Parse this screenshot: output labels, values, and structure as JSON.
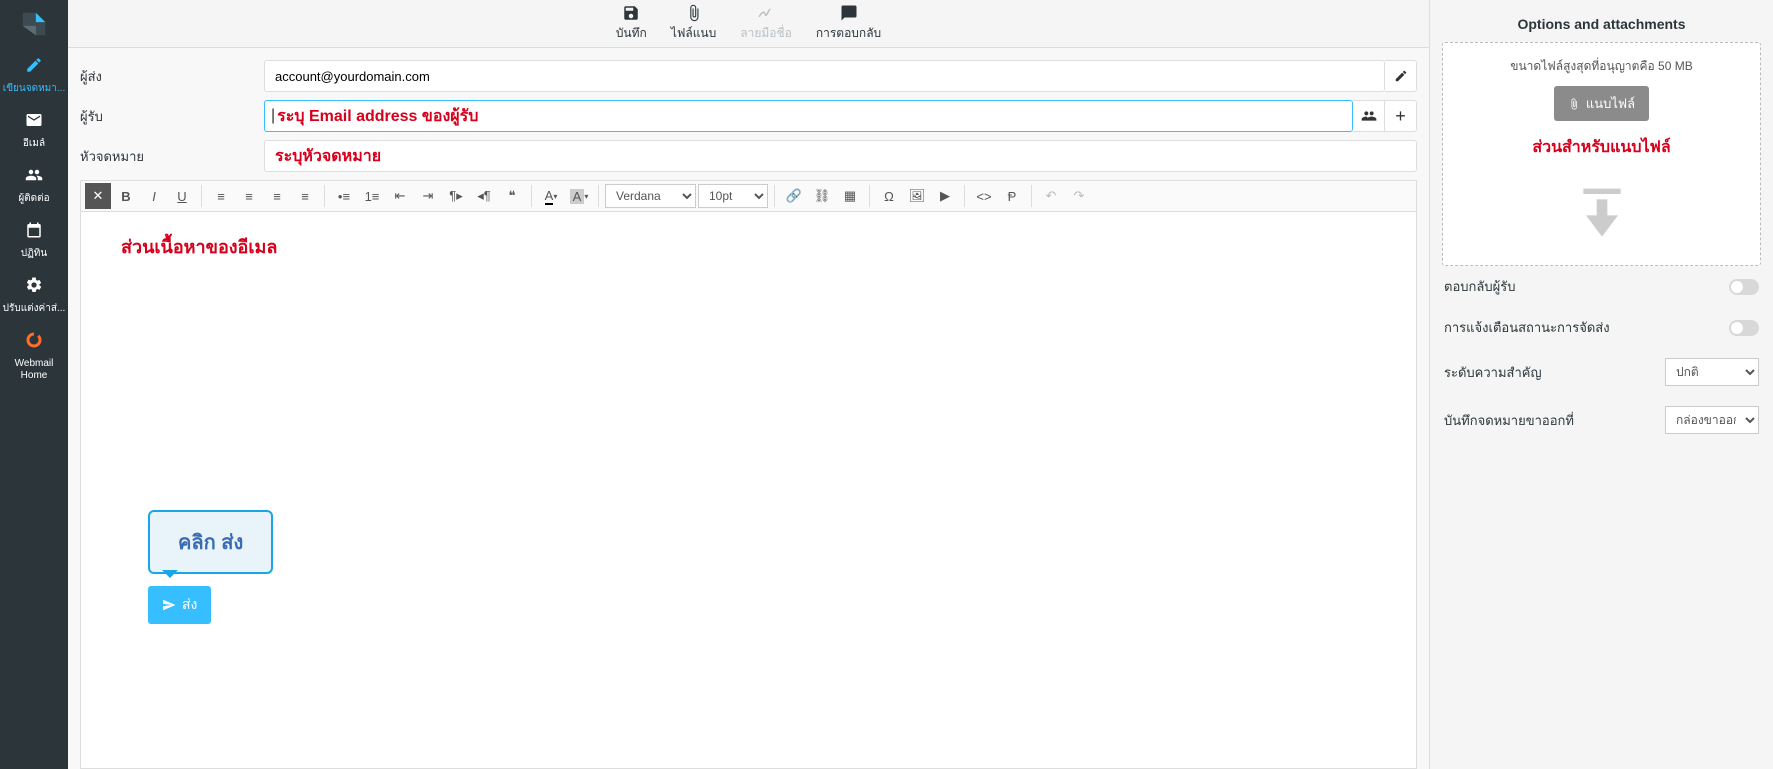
{
  "sidebar": {
    "items": [
      {
        "label": "เขียนจดหมา...",
        "icon": "compose",
        "active": true
      },
      {
        "label": "อีเมล์",
        "icon": "mail"
      },
      {
        "label": "ผู้ติดต่อ",
        "icon": "contacts"
      },
      {
        "label": "ปฏิทิน",
        "icon": "calendar"
      },
      {
        "label": "ปรับแต่งค่าส่...",
        "icon": "settings"
      },
      {
        "label": "Webmail Home",
        "icon": "webmail-home"
      }
    ]
  },
  "toolbar": {
    "save": "บันทึก",
    "attach": "ไฟล์แนบ",
    "signature": "ลายมือชื่อ",
    "reply": "การตอบกลับ"
  },
  "compose": {
    "from_label": "ผู้ส่ง",
    "from_value": "account@yourdomain.com",
    "to_label": "ผู้รับ",
    "to_hint": "ระบุ Email address ของผู้รับ",
    "subject_label": "หัวจดหมาย",
    "subject_hint": "ระบุหัวจดหมาย",
    "body_hint": "ส่วนเนื้อหาของอีเมล"
  },
  "editor": {
    "font_family": "Verdana",
    "font_size": "10pt"
  },
  "send": {
    "callout": "คลิก ส่ง",
    "button": "ส่ง"
  },
  "right": {
    "title": "Options and attachments",
    "limit": "ขนาดไฟล์สูงสุดที่อนุญาตคือ 50 MB",
    "attach_button": "แนบไฟล์",
    "note": "ส่วนสำหรับแนบไฟล์",
    "reply_to_recipient": "ตอบกลับผู้รับ",
    "delivery_status": "การแจ้งเตือนสถานะการจัดส่ง",
    "priority_label": "ระดับความสำคัญ",
    "priority_value": "ปกติ",
    "store_label": "บันทึกจดหมายขาออกที่",
    "store_value": "กล่องขาออก"
  }
}
